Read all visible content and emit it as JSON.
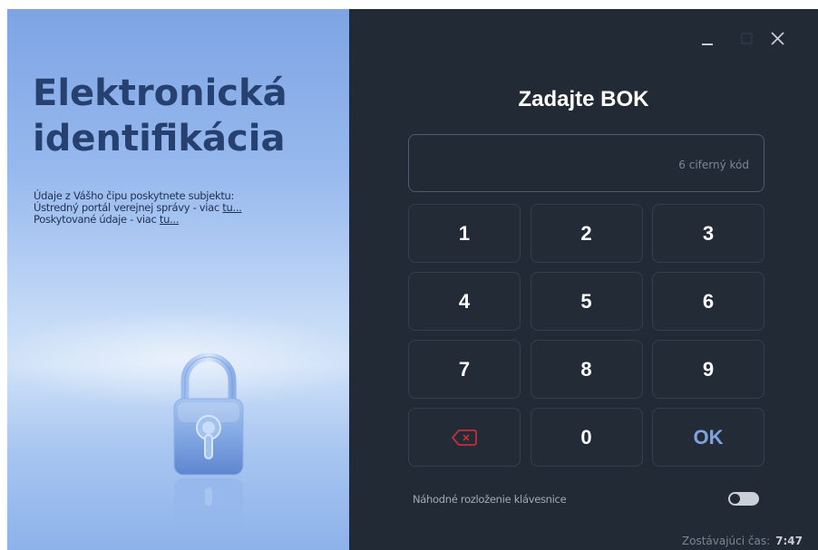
{
  "left_panel": {
    "title_line1": "Elektronická",
    "title_line2": "identifikácia",
    "info": {
      "line1": "Údaje z Vášho čipu poskytnete subjektu:",
      "line2_text": "Ústredný portál verejnej správy - viac ",
      "line2_link": "tu...",
      "line3_text": "Poskytované údaje - viac ",
      "line3_link": "tu..."
    }
  },
  "right_panel": {
    "heading": "Zadajte BOK",
    "pin_input": {
      "value": "",
      "placeholder": "6 ciferný kód"
    },
    "keypad": {
      "keys": [
        "1",
        "2",
        "3",
        "4",
        "5",
        "6",
        "7",
        "8",
        "9",
        "",
        "0",
        "OK"
      ],
      "ok_label": "OK",
      "backspace_icon": "backspace-icon"
    },
    "random_layout_label": "Náhodné rozloženie klávesnice",
    "random_layout_enabled": false,
    "timer_label": "Zostávajúci čas:",
    "timer_value": "7:47"
  },
  "colors": {
    "left_panel_accent": "#26406f",
    "right_panel_background": "#222a36",
    "ok_key": "#7fa3e0",
    "backspace_icon": "#c0303a"
  }
}
